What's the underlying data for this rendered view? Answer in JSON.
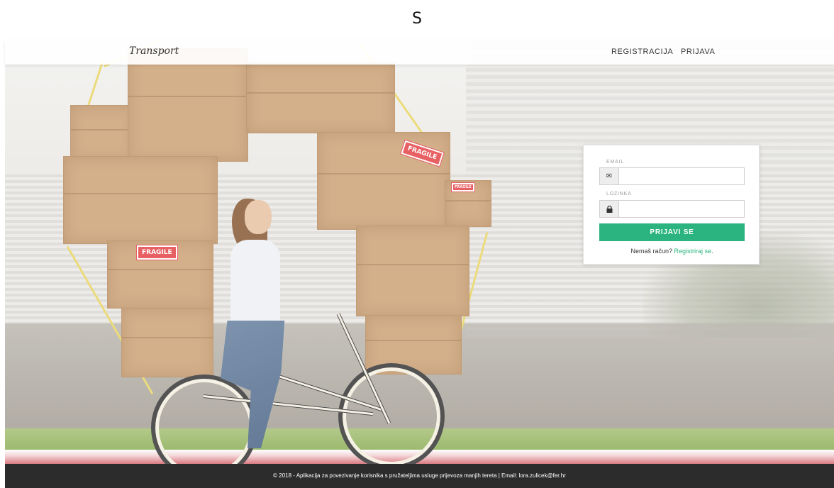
{
  "top_letter": "S",
  "navbar": {
    "brand": "Transport",
    "links": [
      {
        "label": "REGISTRACIJA"
      },
      {
        "label": "PRIJAVA"
      }
    ]
  },
  "hero": {
    "box_labels": [
      "FRAGILE",
      "FRAGILE",
      "FRAGILE"
    ]
  },
  "login": {
    "email_label": "EMAIL",
    "email_icon": "envelope-icon",
    "email_value": "",
    "password_label": "LOZINKA",
    "password_icon": "lock-icon",
    "password_value": "",
    "submit_label": "PRIJAVI SE",
    "signup_prompt": "Nemaš račun?",
    "signup_link": "Registriraj se",
    "signup_suffix": "."
  },
  "footer": {
    "text": "© 2018 - Aplikacija za povezivanje korisnika s pružateljima usluge prijevoza manjih tereta | Email: lora.zulicek@fer.hr"
  },
  "colors": {
    "accent": "#2bb47f",
    "footer_bg": "#2c2c2c"
  }
}
